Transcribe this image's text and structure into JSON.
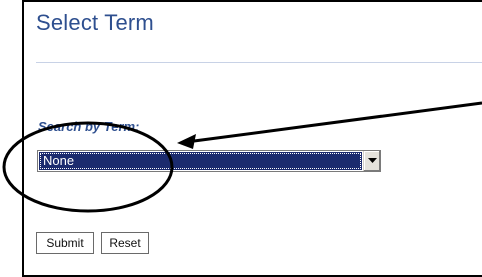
{
  "page": {
    "title": "Select Term"
  },
  "form": {
    "search_label": "Search by Term:",
    "term_select": {
      "selected_value": "None"
    },
    "submit_label": "Submit",
    "reset_label": "Reset"
  },
  "annotation": {
    "color": "#000000",
    "icons": [
      "callout-ellipse",
      "callout-arrow"
    ]
  },
  "colors": {
    "title": "#2e4f8f",
    "select_highlight": "#1c2b6e"
  }
}
